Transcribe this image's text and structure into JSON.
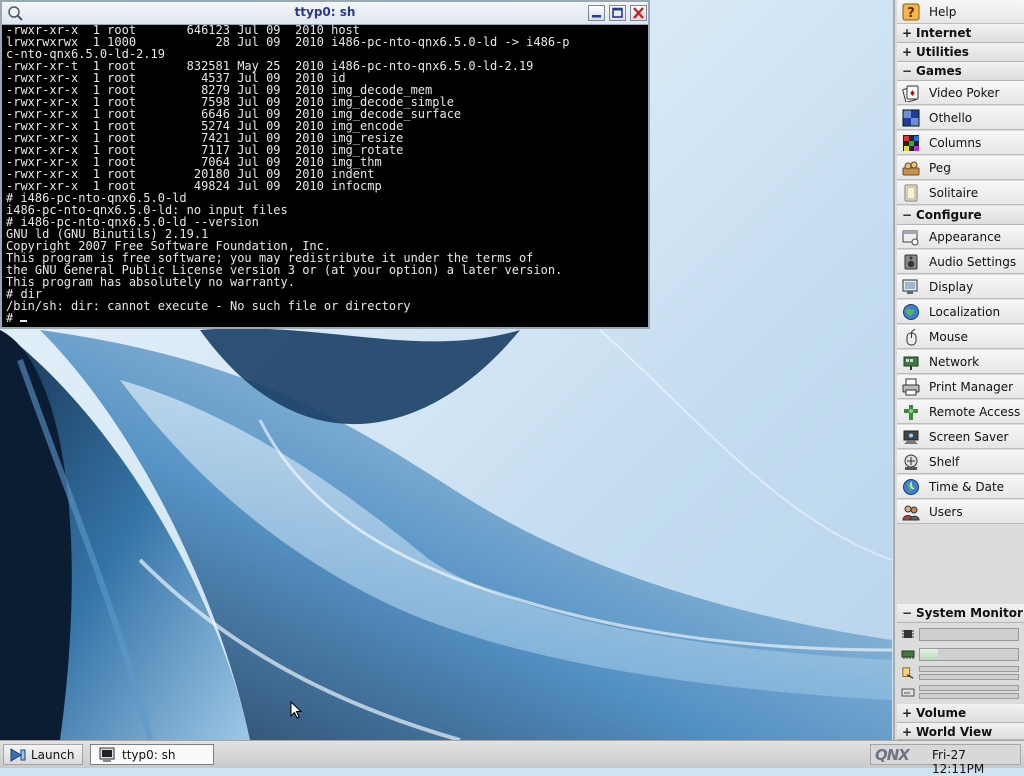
{
  "terminal": {
    "title": "ttyp0: sh",
    "lines": [
      "-rwxr-xr-x  1 root       646123 Jul 09  2010 host",
      "lrwxrwxrwx  1 1000           28 Jul 09  2010 i486-pc-nto-qnx6.5.0-ld -> i486-p",
      "c-nto-qnx6.5.0-ld-2.19",
      "-rwxr-xr-t  1 root       832581 May 25  2010 i486-pc-nto-qnx6.5.0-ld-2.19",
      "-rwxr-xr-x  1 root         4537 Jul 09  2010 id",
      "-rwxr-xr-x  1 root         8279 Jul 09  2010 img_decode_mem",
      "-rwxr-xr-x  1 root         7598 Jul 09  2010 img_decode_simple",
      "-rwxr-xr-x  1 root         6646 Jul 09  2010 img_decode_surface",
      "-rwxr-xr-x  1 root         5274 Jul 09  2010 img_encode",
      "-rwxr-xr-x  1 root         7421 Jul 09  2010 img_resize",
      "-rwxr-xr-x  1 root         7117 Jul 09  2010 img_rotate",
      "-rwxr-xr-x  1 root         7064 Jul 09  2010 img_thm",
      "-rwxr-xr-x  1 root        20180 Jul 09  2010 indent",
      "-rwxr-xr-x  1 root        49824 Jul 09  2010 infocmp",
      "# i486-pc-nto-qnx6.5.0-ld",
      "i486-pc-nto-qnx6.5.0-ld: no input files",
      "# i486-pc-nto-qnx6.5.0-ld --version",
      "GNU ld (GNU Binutils) 2.19.1",
      "Copyright 2007 Free Software Foundation, Inc.",
      "This program is free software; you may redistribute it under the terms of",
      "the GNU General Public License version 3 or (at your option) a later version.",
      "This program has absolutely no warranty.",
      "# dir",
      "/bin/sh: dir: cannot execute - No such file or directory"
    ],
    "prompt": "# "
  },
  "shelf": {
    "help": "Help",
    "internet": "Internet",
    "utilities": "Utilities",
    "games_header": "Games",
    "games": [
      "Video Poker",
      "Othello",
      "Columns",
      "Peg",
      "Solitaire"
    ],
    "configure_header": "Configure",
    "configure": [
      "Appearance",
      "Audio Settings",
      "Display",
      "Localization",
      "Mouse",
      "Network",
      "Print Manager",
      "Remote Access",
      "Screen Saver",
      "Shelf",
      "Time & Date",
      "Users"
    ],
    "system_monitor": "System Monitor",
    "cpu_load": 0.0,
    "memory_used": 0.18,
    "volume": "Volume",
    "world_view": "World View",
    "sign_expanded": "−",
    "sign_collapsed": "+"
  },
  "taskbar": {
    "launch": "Launch",
    "task_terminal": "ttyp0: sh",
    "logo": "QNX",
    "clock": "Fri-27 12:11PM"
  },
  "colors": {
    "terminal_bg": "#000000",
    "terminal_fg": "#e8e8e8",
    "title_text": "#2a3a8c",
    "close_red": "#c81e1e"
  }
}
